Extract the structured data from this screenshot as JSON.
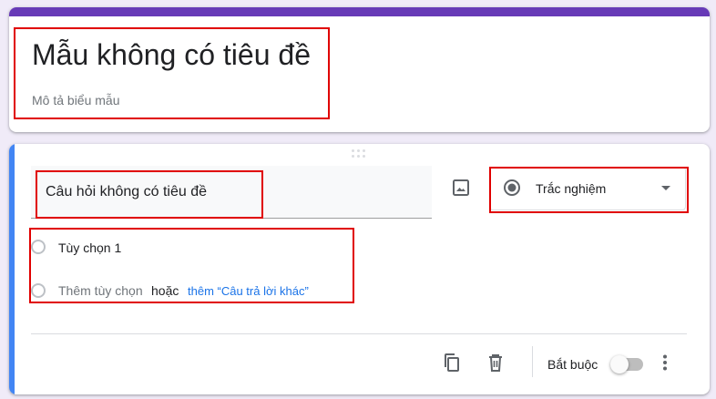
{
  "form": {
    "title": "Mẫu không có tiêu đề",
    "description": "Mô tả biểu mẫu"
  },
  "question": {
    "title": "Câu hỏi không có tiêu đề",
    "type_label": "Trắc nghiệm",
    "options": [
      {
        "label": "Tùy chọn 1"
      }
    ],
    "add_option_label": "Thêm tùy chọn",
    "or_label": "hoặc",
    "add_other_label": "thêm “Câu trả lời khác”",
    "required_label": "Bắt buộc",
    "required_on": false
  },
  "icons": {
    "image": "image-icon",
    "radio_selected": "radio-checked-icon",
    "caret": "caret-down-icon",
    "copy": "copy-icon",
    "delete": "trash-icon",
    "more": "more-vertical-icon",
    "drag": "drag-handle-icon"
  },
  "colors": {
    "theme": "#673ab7",
    "active_stripe": "#4285f4",
    "link": "#1a73e8",
    "background": "#f0ebf8",
    "annotation": "#e00000"
  }
}
